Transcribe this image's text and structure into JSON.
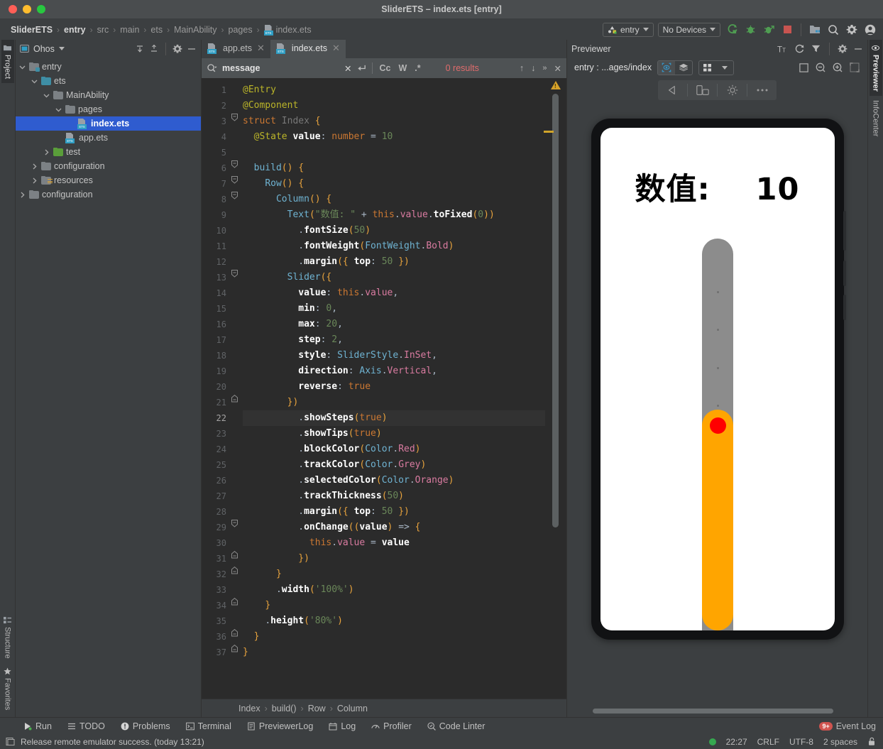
{
  "window": {
    "title": "SliderETS – index.ets [entry]",
    "traffic_lights": [
      "close",
      "minimize",
      "zoom"
    ]
  },
  "breadcrumb": {
    "items": [
      "SliderETS",
      "entry",
      "src",
      "main",
      "ets",
      "MainAbility",
      "pages",
      "index.ets"
    ],
    "separator": "›"
  },
  "toolbar": {
    "run_config": "entry",
    "device": "No Devices",
    "icons": [
      "run-icon",
      "debug-icon",
      "profile-debug-icon",
      "stop-icon",
      "project-structure-icon",
      "search-everywhere-icon",
      "settings-icon",
      "account-icon"
    ],
    "colors": {
      "run_green": "#4f9d52",
      "stop_red": "#c75450",
      "accent_blue": "#3592c4"
    }
  },
  "left_rail": {
    "top": [
      {
        "label": "Project",
        "icon": "project-icon",
        "active": true
      }
    ],
    "bottom": [
      {
        "label": "Structure",
        "icon": "structure-icon"
      },
      {
        "label": "Favorites",
        "icon": "star-icon"
      }
    ]
  },
  "project_panel": {
    "title": "Ohos",
    "icons": [
      "expand-all-icon",
      "collapse-all-icon",
      "settings-icon",
      "hide-icon"
    ],
    "tree": [
      {
        "label": "entry",
        "depth": 0,
        "arrow": "down",
        "icon": "module-folder",
        "selected": false
      },
      {
        "label": "ets",
        "depth": 1,
        "arrow": "down",
        "icon": "teal-folder",
        "selected": false
      },
      {
        "label": "MainAbility",
        "depth": 2,
        "arrow": "down",
        "icon": "folder",
        "selected": false
      },
      {
        "label": "pages",
        "depth": 3,
        "arrow": "down",
        "icon": "folder",
        "selected": false
      },
      {
        "label": "index.ets",
        "depth": 4,
        "arrow": "none",
        "icon": "ets-file",
        "selected": true
      },
      {
        "label": "app.ets",
        "depth": 3,
        "arrow": "none",
        "icon": "ets-file",
        "selected": false
      },
      {
        "label": "test",
        "depth": 2,
        "arrow": "right",
        "icon": "green-folder",
        "selected": false
      },
      {
        "label": "configuration",
        "depth": 1,
        "arrow": "right",
        "icon": "folder",
        "selected": false
      },
      {
        "label": "resources",
        "depth": 1,
        "arrow": "right",
        "icon": "resource-folder",
        "selected": false
      },
      {
        "label": "configuration",
        "depth": 0,
        "arrow": "right",
        "icon": "folder",
        "selected": false
      }
    ]
  },
  "editor": {
    "tabs": [
      {
        "label": "app.ets",
        "active": false
      },
      {
        "label": "index.ets",
        "active": true
      }
    ],
    "find": {
      "value": "message",
      "toggles": [
        "Cc",
        "W",
        ".*"
      ],
      "results": "0 results",
      "icons": [
        "search-icon",
        "clear-icon",
        "newline-icon",
        "prev-match-icon",
        "next-match-icon",
        "more-icon",
        "close-icon"
      ]
    },
    "current_line": 22,
    "total_lines": 37,
    "lines": [
      "@Entry",
      "@Component",
      "struct Index {",
      "  @State value: number = 10",
      "",
      "  build() {",
      "    Row() {",
      "      Column() {",
      "        Text(\"数值: \" + this.value.toFixed(0))",
      "          .fontSize(50)",
      "          .fontWeight(FontWeight.Bold)",
      "          .margin({ top: 50 })",
      "        Slider({",
      "          value: this.value,",
      "          min: 0,",
      "          max: 20,",
      "          step: 2,",
      "          style: SliderStyle.InSet,",
      "          direction: Axis.Vertical,",
      "          reverse: true",
      "        })",
      "          .showSteps(true)",
      "          .showTips(true)",
      "          .blockColor(Color.Red)",
      "          .trackColor(Color.Grey)",
      "          .selectedColor(Color.Orange)",
      "          .trackThickness(50)",
      "          .margin({ top: 50 })",
      "          .onChange((value) => {",
      "            this.value = value",
      "          })",
      "      }",
      "      .width('100%')",
      "    }",
      "    .height('80%')",
      "  }",
      "}"
    ],
    "structure_breadcrumb": [
      "Index",
      "build()",
      "Row",
      "Column"
    ]
  },
  "previewer": {
    "title": "Previewer",
    "head_icons": [
      "font-size-icon",
      "refresh-icon",
      "filter-icon",
      "settings-icon",
      "hide-icon"
    ],
    "route": "entry : ...ages/index",
    "toggle_icons": [
      "inspector-icon",
      "layers-icon"
    ],
    "grid_icon": "multi-device-icon",
    "right_icons": [
      "frame-icon",
      "zoom-out-icon",
      "zoom-in-icon",
      "fit-screen-icon"
    ],
    "device_tools": [
      "rotate-icon",
      "device-icon",
      "brightness-icon",
      "more-icon"
    ],
    "app": {
      "label_text": "数值:",
      "value_text": "10",
      "slider": {
        "value": 10,
        "min": 0,
        "max": 20,
        "step": 2,
        "style": "InSet",
        "direction": "Vertical",
        "reverse": true,
        "track_color": "#8C8C8C",
        "selected_color": "#FFA500",
        "block_color": "#FF0000",
        "track_thickness": 50,
        "show_steps": true,
        "show_tips": true
      }
    }
  },
  "right_rail": {
    "tabs": [
      {
        "label": "Previewer",
        "icon": "eye-icon",
        "active": true
      },
      {
        "label": "InfoCenter",
        "icon": "info-icon",
        "active": false
      }
    ]
  },
  "tool_window_bar": {
    "items": [
      {
        "label": "Run",
        "icon": "run-icon"
      },
      {
        "label": "TODO",
        "icon": "todo-icon"
      },
      {
        "label": "Problems",
        "icon": "problems-icon"
      },
      {
        "label": "Terminal",
        "icon": "terminal-icon"
      },
      {
        "label": "PreviewerLog",
        "icon": "previewerlog-icon"
      },
      {
        "label": "Log",
        "icon": "log-icon"
      },
      {
        "label": "Profiler",
        "icon": "profiler-icon"
      },
      {
        "label": "Code Linter",
        "icon": "code-linter-icon"
      }
    ],
    "event_log": {
      "label": "Event Log",
      "badge": "9+"
    }
  },
  "status_bar": {
    "message": "Release remote emulator success. (today 13:21)",
    "time": "22:27",
    "line_separator": "CRLF",
    "encoding": "UTF-8",
    "indent": "2 spaces",
    "lock_icon": "lock-icon",
    "indicator_color": "#36a850"
  }
}
